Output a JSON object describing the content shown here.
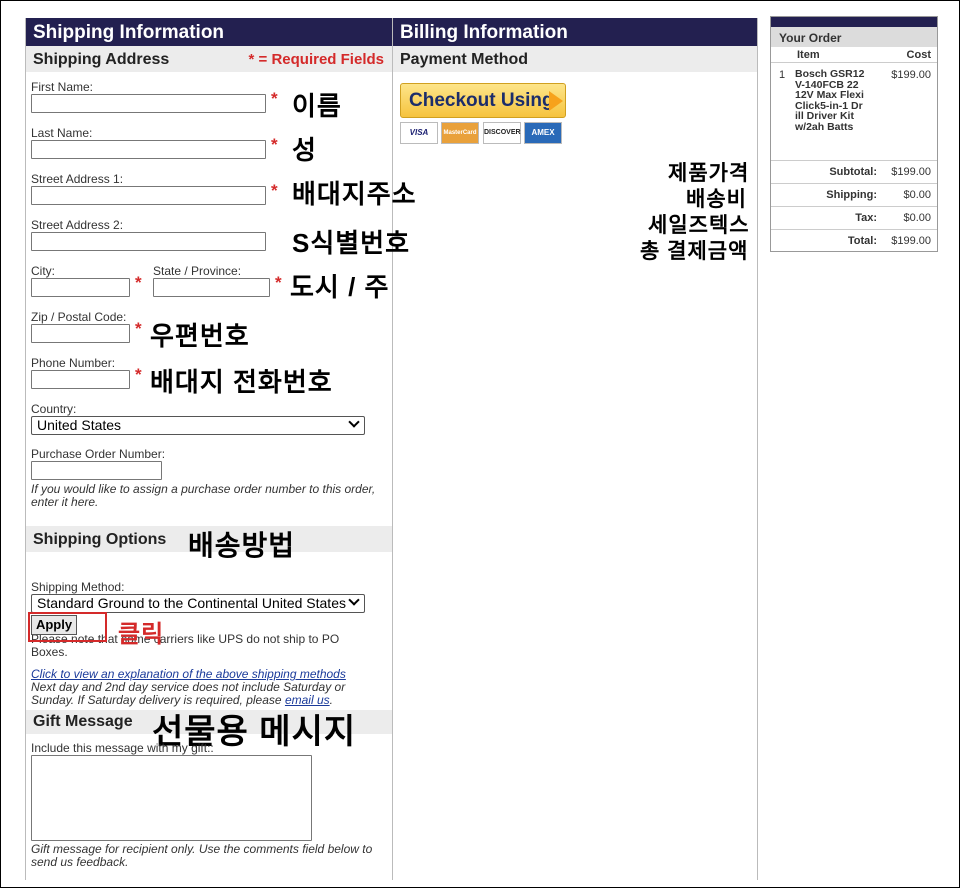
{
  "shipping": {
    "header": "Shipping Information",
    "address_title": "Shipping Address",
    "required_note": "* = Required Fields",
    "fields": {
      "first_name": "First Name:",
      "last_name": "Last Name:",
      "street1": "Street Address 1:",
      "street2": "Street Address 2:",
      "city": "City:",
      "state": "State / Province:",
      "zip": "Zip / Postal Code:",
      "phone": "Phone Number:",
      "country": "Country:",
      "country_value": "United States",
      "po": "Purchase Order Number:",
      "po_note": "If you would like to assign a purchase order number to this order, enter it here."
    },
    "star": "*",
    "options_title": "Shipping Options",
    "method_label": "Shipping Method:",
    "method_value": "Standard Ground to the Continental United States",
    "apply": "Apply",
    "po_box_note": "Please note that some carriers like UPS do not ship to PO Boxes.",
    "explain_link": "Click to view an explanation of the above shipping methods",
    "delivery_note": "Next day and 2nd day service does not include Saturday or Sunday. If Saturday delivery is required, please",
    "email_link": "email us",
    "period": ".",
    "gift_title": "Gift Message",
    "gift_label": "Include this message with my gift::",
    "gift_note": "Gift message for recipient only. Use the comments field below to send us feedback."
  },
  "annotations": {
    "first_name": "이름",
    "last_name": "성",
    "street1": "배대지주소",
    "street2": "S식별번호",
    "city_state": "도시 / 주",
    "zip": "우편번호",
    "phone": "배대지 전화번호",
    "shipping_method": "배송방법",
    "click": "클릭",
    "gift": "선물용 메시지",
    "price": "제품가격",
    "ship_cost": "배송비",
    "tax": "세일즈텍스",
    "total": "총 결제금액"
  },
  "billing": {
    "header": "Billing Information",
    "payment_title": "Payment Method",
    "checkout_label": "Checkout Using",
    "cards": [
      "VISA",
      "MasterCard",
      "DISCOVER",
      "AMEX"
    ]
  },
  "order": {
    "title": "Your Order",
    "col_item": "Item",
    "col_cost": "Cost",
    "item_qty": "1",
    "item_name": "Bosch GSR12V-140FCB 22 12V Max FlexiClick5-in-1 Drill Driver Kit w/2ah Batts",
    "item_cost": "$199.00",
    "subtotal_label": "Subtotal:",
    "subtotal": "$199.00",
    "shipping_label": "Shipping:",
    "shipping": "$0.00",
    "tax_label": "Tax:",
    "tax": "$0.00",
    "total_label": "Total:",
    "total": "$199.00"
  },
  "colors": {
    "header_navy": "#232050",
    "required_red": "#d42a2a",
    "section_gray": "#ececec"
  }
}
